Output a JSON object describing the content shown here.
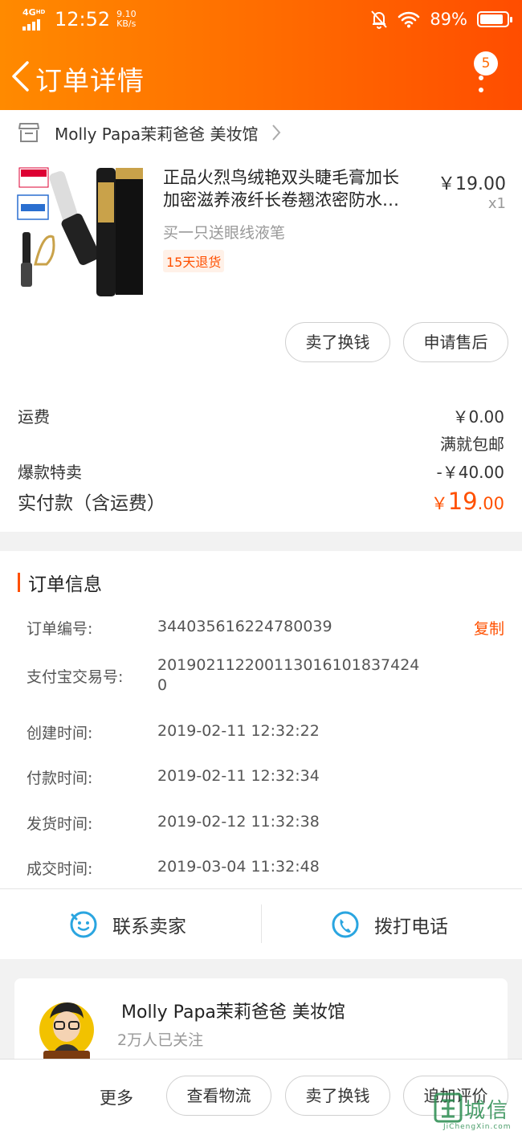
{
  "status_bar": {
    "network": "4G",
    "network_sup": "HD",
    "time": "12:52",
    "speed_value": "9.10",
    "speed_unit": "KB/s",
    "battery": "89%",
    "battery_level": 0.89
  },
  "nav": {
    "title": "订单详情",
    "badge": "5"
  },
  "store": {
    "name": "Molly Papa茉莉爸爸 美妆馆"
  },
  "product": {
    "title_line1": "正品火烈鸟绒艳双头睫毛膏加长",
    "title_line2": "加密滋养液纤长卷翘浓密防水…",
    "price": "￥19.00",
    "qty": "x1",
    "sku": "买一只送眼线液笔",
    "tag": "15天退货"
  },
  "item_actions": {
    "sell": "卖了换钱",
    "after_sale": "申请售后"
  },
  "fees": {
    "shipping_label": "运费",
    "shipping_value": "￥0.00",
    "shipping_note": "满就包邮",
    "promo_label": "爆款特卖",
    "promo_value": "-￥40.00",
    "paid_label": "实付款（含运费）",
    "paid_currency": "￥",
    "paid_int": "19",
    "paid_dec": ".00"
  },
  "order_info": {
    "title": "订单信息",
    "copy": "复制",
    "rows": [
      {
        "label": "订单编号:",
        "value": "344035616224780039"
      },
      {
        "label": "支付宝交易号:",
        "value": "20190211220011301610183742​40"
      },
      {
        "label": "创建时间:",
        "value": "2019-02-11 12:32:22"
      },
      {
        "label": "付款时间:",
        "value": "2019-02-11 12:32:34"
      },
      {
        "label": "发货时间:",
        "value": "2019-02-12 11:32:38"
      },
      {
        "label": "成交时间:",
        "value": "2019-03-04 11:32:48"
      }
    ],
    "alipay_line1": "201902112200113016101837424",
    "alipay_line2": "0"
  },
  "contact": {
    "seller": "联系卖家",
    "phone": "拨打电话"
  },
  "shop_card": {
    "name": "Molly Papa茉莉爸爸 美妆馆",
    "followers": "2万人已关注"
  },
  "bottom_bar": {
    "more": "更多",
    "logistics": "查看物流",
    "sell": "卖了换钱",
    "review": "追加评价"
  },
  "watermark": {
    "text": "城信",
    "sub": "JiChengXin.com"
  },
  "colors": {
    "accent": "#ff5000",
    "header_start": "#ff8a00",
    "header_end": "#ff4d00",
    "contact_icon": "#2aa5e0"
  }
}
